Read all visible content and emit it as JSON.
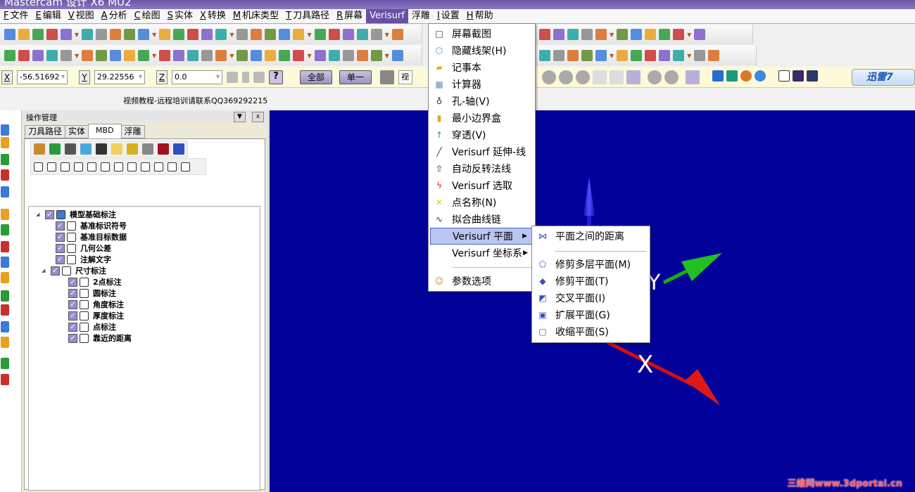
{
  "title": "Mastercam 设计 X6 MU2",
  "menubar": [
    {
      "key": "F",
      "label": "文件"
    },
    {
      "key": "E",
      "label": "编辑"
    },
    {
      "key": "V",
      "label": "视图"
    },
    {
      "key": "A",
      "label": "分析"
    },
    {
      "key": "C",
      "label": "绘图"
    },
    {
      "key": "S",
      "label": "实体"
    },
    {
      "key": "X",
      "label": "转换"
    },
    {
      "key": "M",
      "label": "机床类型"
    },
    {
      "key": "T",
      "label": "刀具路径"
    },
    {
      "key": "R",
      "label": "屏幕"
    },
    {
      "key": "",
      "label": "Verisurf"
    },
    {
      "key": "",
      "label": "浮雕"
    },
    {
      "key": "I",
      "label": "设置"
    },
    {
      "key": "H",
      "label": "帮助"
    }
  ],
  "coords": {
    "x_label": "X",
    "x_value": "-56.51692",
    "y_label": "Y",
    "y_value": "29.22556",
    "z_label": "Z",
    "z_value": "0.0",
    "all_button": "全部",
    "single_button": "单一",
    "view_partial": "视"
  },
  "info_text": "视频教程-远程培训请联系QQ369292215",
  "opmgr": {
    "title": "操作管理",
    "close": "x",
    "tabs": [
      "刀具路径",
      "实体",
      "MBD",
      "浮雕"
    ],
    "tree": [
      {
        "label": "模型基础标注",
        "level": 0,
        "expand": true
      },
      {
        "label": "基准标识符号",
        "level": 1
      },
      {
        "label": "基准目标数据",
        "level": 1
      },
      {
        "label": "几何公差",
        "level": 1
      },
      {
        "label": "注解文字",
        "level": 1
      },
      {
        "label": "尺寸标注",
        "level": 1,
        "expand": true
      },
      {
        "label": "2点标注",
        "level": 2
      },
      {
        "label": "圆标注",
        "level": 2
      },
      {
        "label": "角度标注",
        "level": 2
      },
      {
        "label": "厚度标注",
        "level": 2
      },
      {
        "label": "点标注",
        "level": 2
      },
      {
        "label": "靠近的距离",
        "level": 2
      }
    ]
  },
  "verisurf_menu": [
    {
      "label": "屏幕截图",
      "icon": "screenshot-icon"
    },
    {
      "label": "隐藏线架(H)",
      "icon": "cube-wire-icon"
    },
    {
      "label": "记事本",
      "icon": "notepad-icon"
    },
    {
      "label": "计算器",
      "icon": "calculator-icon"
    },
    {
      "label": "孔-轴(V)",
      "icon": "hole-axis-icon"
    },
    {
      "label": "最小边界盒",
      "icon": "bounding-box-icon"
    },
    {
      "label": "穿透(V)",
      "icon": "pierce-arrow-icon"
    },
    {
      "label": "Verisurf 延伸-线",
      "icon": "line-icon"
    },
    {
      "label": "自动反转法线",
      "icon": "flip-normal-icon"
    },
    {
      "label": "Verisurf 选取",
      "icon": "lightning-icon"
    },
    {
      "label": "点名称(N)",
      "icon": "point-name-icon"
    },
    {
      "label": "拟合曲线链",
      "icon": "curve-icon"
    },
    {
      "label": "Verisurf 平面",
      "submenu": true
    },
    {
      "label": "Verisurf 坐标系",
      "submenu": true
    },
    {
      "label": "参数选项",
      "icon": "options-icon"
    }
  ],
  "plane_submenu": [
    {
      "label": "平面之间的距离",
      "icon": "plane-distance-icon"
    },
    {
      "label": "修剪多层平面(M)",
      "icon": "trim-multi-plane-icon"
    },
    {
      "label": "修剪平面(T)",
      "icon": "trim-plane-icon"
    },
    {
      "label": "交叉平面(I)",
      "icon": "intersect-plane-icon"
    },
    {
      "label": "扩展平面(G)",
      "icon": "extend-plane-icon"
    },
    {
      "label": "收缩平面(S)",
      "icon": "shrink-plane-icon"
    }
  ],
  "axes": {
    "x": "X",
    "y": "Y"
  },
  "xunlei": "迅雷7",
  "watermark": "三维网www.3dportal.cn",
  "colors": {
    "viewport": "#02029a",
    "title": "#6b56a8",
    "menu_highlight": "#b9c6f2"
  }
}
